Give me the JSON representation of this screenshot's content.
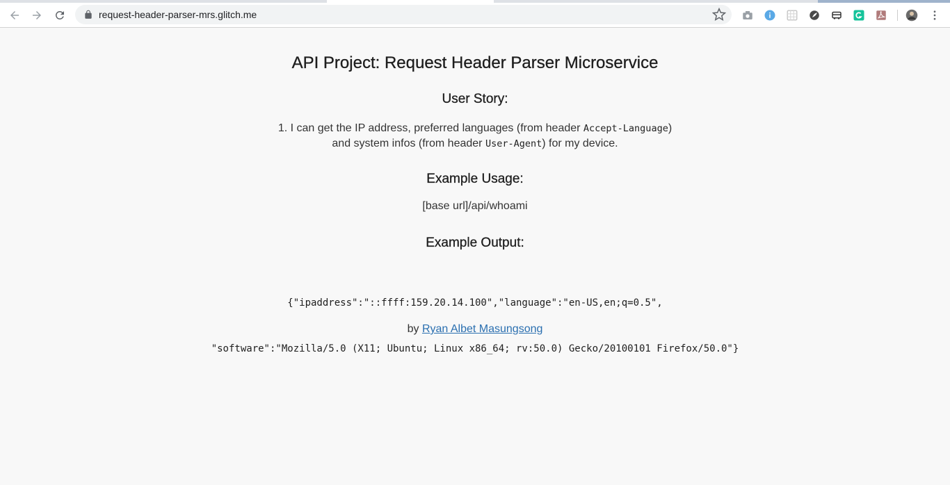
{
  "browser": {
    "url": "request-header-parser-mrs.glitch.me",
    "icons": {
      "back": "back-arrow-icon",
      "forward": "forward-arrow-icon",
      "reload": "reload-icon",
      "lock": "lock-icon",
      "star": "bookmark-star-icon",
      "menu": "kebab-menu-icon"
    },
    "extensions": [
      "camera-icon",
      "info-icon",
      "grid-icon",
      "leaf-icon",
      "bus-icon",
      "grammarly-icon",
      "pdf-icon",
      "profile-avatar"
    ]
  },
  "page": {
    "title": "API Project: Request Header Parser Microservice",
    "story_heading": "User Story:",
    "story_part1": "1. I can get the IP address, preferred languages (from header ",
    "story_code1": "Accept-Language",
    "story_part2": ")",
    "story_part3": "and system infos (from header ",
    "story_code2": "User-Agent",
    "story_part4": ") for my device.",
    "usage_heading": "Example Usage:",
    "usage_text": "[base url]/api/whoami",
    "output_heading": "Example Output:",
    "output_line1": "{\"ipaddress\":\"::ffff:159.20.14.100\",\"language\":\"en-US,en;q=0.5\",",
    "output_line2": "\"software\":\"Mozilla/5.0 (X11; Ubuntu; Linux x86_64; rv:50.0) Gecko/20100101 Firefox/50.0\"}",
    "footer_by": "by ",
    "footer_author": "Ryan Albet Masungsong"
  },
  "colors": {
    "page_bg": "#f8f8f8",
    "link": "#2a6fb0"
  }
}
